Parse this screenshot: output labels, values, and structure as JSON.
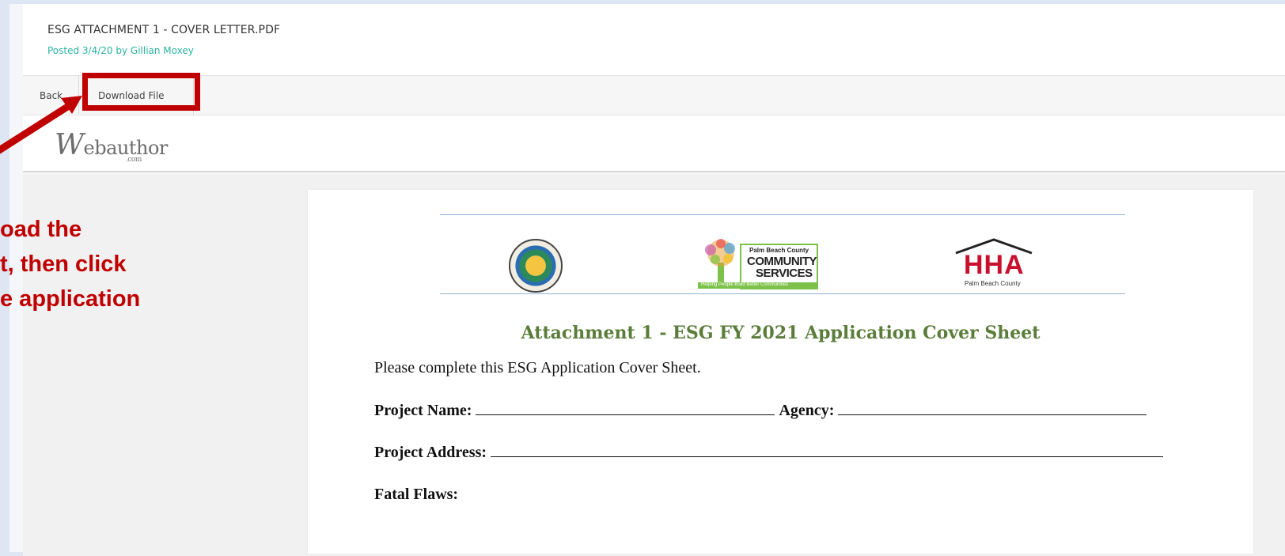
{
  "file": {
    "title": "ESG ATTACHMENT 1 - COVER LETTER.PDF",
    "meta": "Posted 3/4/20 by Gillian Moxey"
  },
  "toolbar": {
    "back_label": "Back",
    "download_label": "Download File"
  },
  "brand": {
    "initial": "W",
    "rest": "ebauthor",
    "suffix": ".com"
  },
  "annotation": {
    "lines": [
      "oad the",
      "t, then click",
      "e application"
    ],
    "color": "#c00000"
  },
  "document": {
    "title": "Attachment 1 - ESG FY 2021 Application Cover Sheet",
    "intro": "Please complete this ESG Application Cover Sheet.",
    "project_name_label": "Project Name:",
    "agency_label": "Agency:",
    "project_address_label": "Project Address:",
    "fatal_flaws_label": "Fatal Flaws:",
    "logos": {
      "cs_small": "Palm Beach County",
      "cs_line1": "COMMUNITY",
      "cs_line2": "SERVICES",
      "cs_tagline": "Helping People Build Better Communities",
      "hha_main": "HHA",
      "hha_sub": "Palm Beach County"
    }
  },
  "colors": {
    "accent_teal": "#2bb3a0",
    "title_green": "#5a7d3a",
    "highlight_red": "#c00000"
  }
}
